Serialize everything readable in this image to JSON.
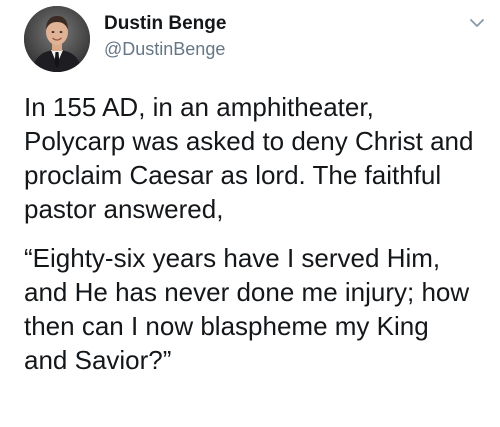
{
  "author": {
    "display_name": "Dustin Benge",
    "handle": "@DustinBenge"
  },
  "icons": {
    "avatar": "profile-photo",
    "menu": "chevron-down-icon"
  },
  "tweet": {
    "paragraph_1": "In 155 AD, in an amphitheater,\nPolycarp was asked to deny Christ and\nproclaim Caesar as lord. The faithful\npastor answered,",
    "paragraph_2": "“Eighty-six years have I served Him,\nand He has never done me injury; how\nthen can I now blaspheme my King\nand Savior?”"
  },
  "colors": {
    "text": "#14171a",
    "secondary_text": "#657786",
    "chevron": "#8899a6",
    "background": "#ffffff"
  }
}
